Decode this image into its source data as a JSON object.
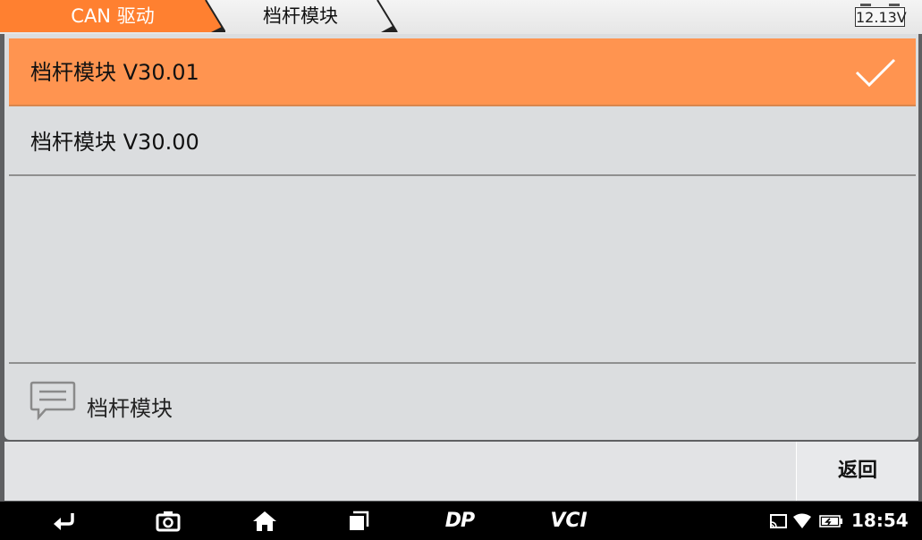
{
  "breadcrumb": {
    "items": [
      "CAN 驱动",
      "档杆模块"
    ],
    "active_color": "#ff8030"
  },
  "battery": {
    "voltage": "12.13V"
  },
  "list": {
    "items": [
      {
        "label": "档杆模块  V30.01",
        "selected": true
      },
      {
        "label": "档杆模块  V30.00",
        "selected": false
      }
    ],
    "selected_color": "#ff9450"
  },
  "message": {
    "text": "档杆模块",
    "icon": "message-icon"
  },
  "footer": {
    "back_label": "返回"
  },
  "navbar": {
    "icons": [
      "back-icon",
      "camera-icon",
      "home-icon",
      "recent-apps-icon",
      "dp-icon",
      "vci-icon"
    ],
    "dp_label": "DP",
    "vci_label": "VCI",
    "status_icons": [
      "cast-icon",
      "wifi-icon",
      "battery-status-icon"
    ],
    "time": "18:54"
  }
}
